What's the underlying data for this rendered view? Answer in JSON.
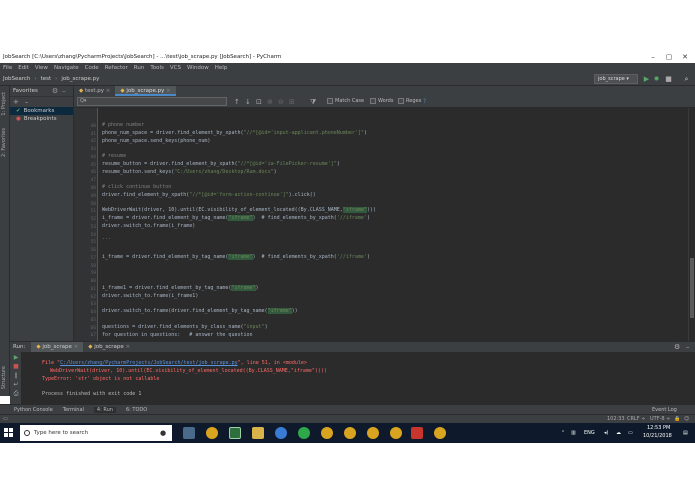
{
  "window": {
    "title": "JobSearch [C:\\Users\\zhang\\PycharmProjects\\JobSearch] - ...\\test\\job_scrape.py [JobSearch] - PyCharm",
    "minimize": "–",
    "maximize": "▢",
    "close": "✕"
  },
  "menu": [
    "File",
    "Edit",
    "View",
    "Navigate",
    "Code",
    "Refactor",
    "Run",
    "Tools",
    "VCS",
    "Window",
    "Help"
  ],
  "nav": {
    "crumbs": [
      "JobSearch",
      "test",
      "job_scrape.py"
    ],
    "sep": "›",
    "run_config": "job_scrape ▾"
  },
  "favorites": {
    "header": "Favorites",
    "items": [
      {
        "label": "Bookmarks",
        "selected": true
      },
      {
        "label": "Breakpoints",
        "selected": false
      }
    ]
  },
  "tool_strip": {
    "project": "1: Project",
    "favorites": "2: Favorites",
    "structure": "Structure"
  },
  "tabs": [
    {
      "label": "test.py",
      "active": false
    },
    {
      "label": "job_scrape.py",
      "active": true
    }
  ],
  "find": {
    "placeholder": "Q▾",
    "match_case": "Match Case",
    "words": "Words",
    "regex": "Regex"
  },
  "gutter": [
    "",
    "",
    "40",
    "41",
    "42",
    "43",
    "44",
    "45",
    "46",
    "47",
    "48",
    "49",
    "50",
    "51",
    "52",
    "53",
    "54",
    "55",
    "56",
    "57",
    "58",
    "59",
    "60",
    "61",
    "62",
    "63",
    "64",
    "65",
    "66",
    "67",
    "68",
    "69"
  ],
  "code": {
    "l0": "",
    "phone_cm": "# phone number",
    "phone1_a": "phone_num_space = driver.find_element_by_xpath(",
    "phone1_s": "\"//*[@id='input-applicant.phoneNumber']\"",
    "phone1_b": ")",
    "phone2": "phone_num_space.send_keys(phone_num)",
    "resume_cm": "# resume",
    "resume1_a": "resume_button = driver.find_element_by_xpath(",
    "resume1_s": "\"//*[@id='ia-FilePicker-resume']\"",
    "resume1_b": ")",
    "resume2_a": "resume_button.send_keys(",
    "resume2_s": "\"C:/Users/zhang/Desktop/Rum.docx\"",
    "resume2_b": ")",
    "click_cm": "# click continue button",
    "click1_a": "driver.find_element_by_xpath(",
    "click1_s": "\"//*[@id='form-action-continue']\"",
    "click1_b": ").click()",
    "wait_a": "WebDriverWait(driver, 10).until(EC.visibility_of_element_located((By.CLASS_NAME,",
    "wait_s": "\"iframe\"",
    "wait_b": ")))",
    "iframe1_a": "i_frame = driver.find_element_by_tag_name(",
    "iframe1_s": "\"iframe\"",
    "iframe1_b": ")  # find_elements_by_xpath(",
    "iframe1_s2": "'//iframe'",
    "iframe1_c": ")",
    "switch1": "driver.switch_to.frame(i_frame)",
    "ellipsis": "...",
    "iframe2_a": "i_frame = driver.find_element_by_tag_name(",
    "iframe2_s": "\"iframe\"",
    "iframe2_b": ")  # find_elements_by_xpath(",
    "iframe2_s2": "'//iframe'",
    "iframe2_c": ")",
    "iframe3_a": "i_frame1 = driver.find_element_by_tag_name(",
    "iframe3_s": "\"iframe\"",
    "iframe3_b": ")",
    "switch2": "driver.switch_to.frame(i_frame1)",
    "switch3_a": "driver.switch_to.frame(driver.find_element_by_tag_name(",
    "switch3_s": "\"iframe\"",
    "switch3_b": "))",
    "questions_a": "questions = driver.find_elements_by_class_name(",
    "questions_s": "\"input\"",
    "questions_b": ")",
    "for_line": "for question in questions:   # answer the question"
  },
  "run": {
    "label": "Run:",
    "tabs": [
      {
        "label": "job_scrape",
        "active": true
      },
      {
        "label": "job_scrape",
        "active": false
      }
    ],
    "console": {
      "file_a": "File \"",
      "file_link": "C:/Users/zhang/PycharmProjects/JobSearch/test/job_scrape.py",
      "file_b": "\", line 51, in <module>",
      "wait": "WebDriverWait(driver, 10).until(EC.visibility_of_element_located((By.CLASS_NAME,\"iframe\"))))",
      "error": "TypeError: 'str' object is not callable",
      "finished": "Process finished with exit code 1"
    }
  },
  "bottom_tools": [
    "Python Console",
    "Terminal",
    "4: Run",
    "6: TODO"
  ],
  "event_log": "Event Log",
  "status": {
    "position": "102:33",
    "line_sep": "CRLF ÷",
    "encoding": "UTF-8 ÷"
  },
  "taskbar": {
    "search_placeholder": "Type here to search",
    "lang": "ENG",
    "time": "12:53 PM",
    "date": "10/21/2018"
  },
  "colors": {
    "editor_bg": "#2b2b2b",
    "panel_bg": "#3c3f41",
    "string": "#6a8759",
    "comment": "#808080",
    "error": "#ff6b68",
    "link": "#5894e0",
    "taskbar": "#0e1a2b"
  }
}
